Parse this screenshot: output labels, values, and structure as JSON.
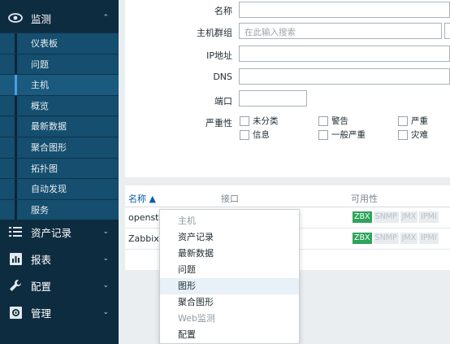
{
  "sidebar": {
    "monitoring": {
      "label": "监测",
      "chevron": "⌃"
    },
    "sub_items": [
      {
        "label": "仪表板",
        "active": false
      },
      {
        "label": "问题",
        "active": false
      },
      {
        "label": "主机",
        "active": true
      },
      {
        "label": "概览",
        "active": false
      },
      {
        "label": "最新数据",
        "active": false
      },
      {
        "label": "聚合图形",
        "active": false
      },
      {
        "label": "拓扑图",
        "active": false
      },
      {
        "label": "自动发现",
        "active": false
      },
      {
        "label": "服务",
        "active": false
      }
    ],
    "sections": [
      {
        "label": "资产记录",
        "icon": "list-icon"
      },
      {
        "label": "报表",
        "icon": "bar-chart-icon"
      },
      {
        "label": "配置",
        "icon": "wrench-icon"
      },
      {
        "label": "管理",
        "icon": "gear-icon"
      }
    ]
  },
  "filter": {
    "name_label": "名称",
    "name_value": "",
    "hostgroup_label": "主机群组",
    "hostgroup_placeholder": "在此输入搜索",
    "ip_label": "IP地址",
    "ip_value": "",
    "dns_label": "DNS",
    "dns_value": "",
    "port_label": "端口",
    "port_value": "",
    "severity_label": "严重性",
    "severities": [
      "未分类",
      "警告",
      "严重",
      "信息",
      "一般严重",
      "灾难"
    ]
  },
  "table": {
    "columns": {
      "name": "名称 ▲",
      "interface": "接口",
      "availability": "可用性"
    },
    "rows": [
      {
        "host": "openstac",
        "tags": [
          "ZBX",
          "SNMP",
          "JMX",
          "IPMI"
        ]
      },
      {
        "host": "Zabbix s",
        "tags": [
          "ZBX",
          "SNMP",
          "JMX",
          "IPMI"
        ]
      }
    ]
  },
  "context_menu": {
    "items": [
      {
        "label": "主机",
        "header": true
      },
      {
        "label": "资产记录",
        "header": false
      },
      {
        "label": "最新数据",
        "header": false
      },
      {
        "label": "问题",
        "header": false
      },
      {
        "label": "图形",
        "header": false,
        "highlight": true
      },
      {
        "label": "聚合图形",
        "header": false
      },
      {
        "label": "Web监测",
        "header": true
      },
      {
        "label": "配置",
        "header": false
      }
    ]
  },
  "colors": {
    "sidebar_bg": "#0e2c40",
    "submenu_bg": "#154e6e",
    "accent": "#4b9ee0",
    "zbx_available": "#2da45a"
  }
}
